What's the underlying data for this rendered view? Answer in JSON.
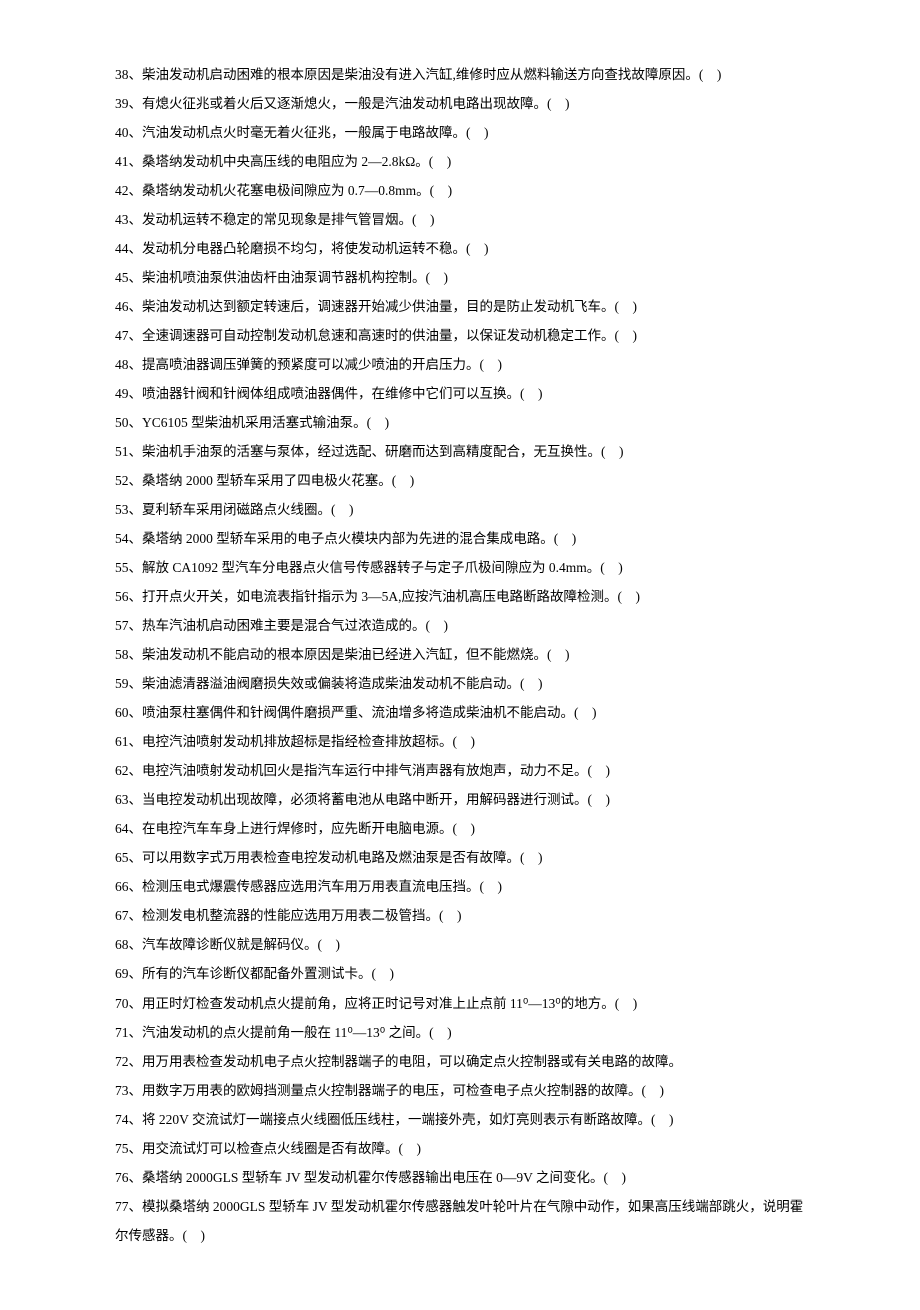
{
  "lines": [
    "38、柴油发动机启动困难的根本原因是柴油没有进入汽缸,维修时应从燃料输送方向查找故障原因。(    )",
    "39、有熄火征兆或着火后又逐渐熄火，一般是汽油发动机电路出现故障。(    )",
    "40、汽油发动机点火时毫无着火征兆，一般属于电路故障。(    )",
    "41、桑塔纳发动机中央高压线的电阻应为 2—2.8kΩ。(    )",
    "42、桑塔纳发动机火花塞电极间隙应为 0.7—0.8mm。(    )",
    "43、发动机运转不稳定的常见现象是排气管冒烟。(    )",
    "44、发动机分电器凸轮磨损不均匀，将使发动机运转不稳。(    )",
    "45、柴油机喷油泵供油齿杆由油泵调节器机构控制。(    )",
    "46、柴油发动机达到额定转速后，调速器开始减少供油量，目的是防止发动机飞车。(    )",
    "47、全速调速器可自动控制发动机怠速和高速时的供油量，以保证发动机稳定工作。(    )",
    "48、提高喷油器调压弹簧的预紧度可以减少喷油的开启压力。(    )",
    "49、喷油器针阀和针阀体组成喷油器偶件，在维修中它们可以互换。(    )",
    "50、YC6105 型柴油机采用活塞式输油泵。(    )",
    "51、柴油机手油泵的活塞与泵体，经过选配、研磨而达到高精度配合，无互换性。(    )",
    "52、桑塔纳 2000 型轿车采用了四电极火花塞。(    )",
    "53、夏利轿车采用闭磁路点火线圈。(    )",
    "54、桑塔纳 2000 型轿车采用的电子点火模块内部为先进的混合集成电路。(    )",
    "55、解放 CA1092 型汽车分电器点火信号传感器转子与定子爪极间隙应为 0.4mm。(    )",
    "56、打开点火开关，如电流表指针指示为 3—5A,应按汽油机高压电路断路故障检测。(    )",
    "57、热车汽油机启动困难主要是混合气过浓造成的。(    )",
    "58、柴油发动机不能启动的根本原因是柴油已经进入汽缸，但不能燃烧。(    )",
    "59、柴油滤清器溢油阀磨损失效或偏装将造成柴油发动机不能启动。(    )",
    "60、喷油泵柱塞偶件和针阀偶件磨损严重、流油增多将造成柴油机不能启动。(    )",
    "61、电控汽油喷射发动机排放超标是指经检查排放超标。(    )",
    "62、电控汽油喷射发动机回火是指汽车运行中排气消声器有放炮声，动力不足。(    )",
    "63、当电控发动机出现故障，必须将蓄电池从电路中断开，用解码器进行测试。(    )",
    "64、在电控汽车车身上进行焊修时，应先断开电脑电源。(    )",
    "65、可以用数字式万用表检查电控发动机电路及燃油泵是否有故障。(    )",
    "66、检测压电式爆震传感器应选用汽车用万用表直流电压挡。(    )",
    "67、检测发电机整流器的性能应选用万用表二极管挡。(    )",
    "68、汽车故障诊断仪就是解码仪。(    )",
    "69、所有的汽车诊断仪都配备外置测试卡。(    )",
    "70、用正时灯检查发动机点火提前角，应将正时记号对准上止点前 11⁰—13⁰的地方。(    )",
    "71、汽油发动机的点火提前角一般在 11⁰—13⁰ 之间。(    )",
    "72、用万用表检查发动机电子点火控制器端子的电阻，可以确定点火控制器或有关电路的故障。",
    "73、用数字万用表的欧姆挡测量点火控制器端子的电压，可检查电子点火控制器的故障。(    )",
    "74、将 220V 交流试灯一端接点火线圈低压线柱，一端接外壳，如灯亮则表示有断路故障。(    )",
    "75、用交流试灯可以检查点火线圈是否有故障。(    )",
    "76、桑塔纳 2000GLS 型轿车 JV 型发动机霍尔传感器输出电压在 0—9V 之间变化。(    )",
    "77、模拟桑塔纳 2000GLS 型轿车 JV 型发动机霍尔传感器触发叶轮叶片在气隙中动作，如果高压线端部跳火，说明霍尔传感器。(    )"
  ]
}
